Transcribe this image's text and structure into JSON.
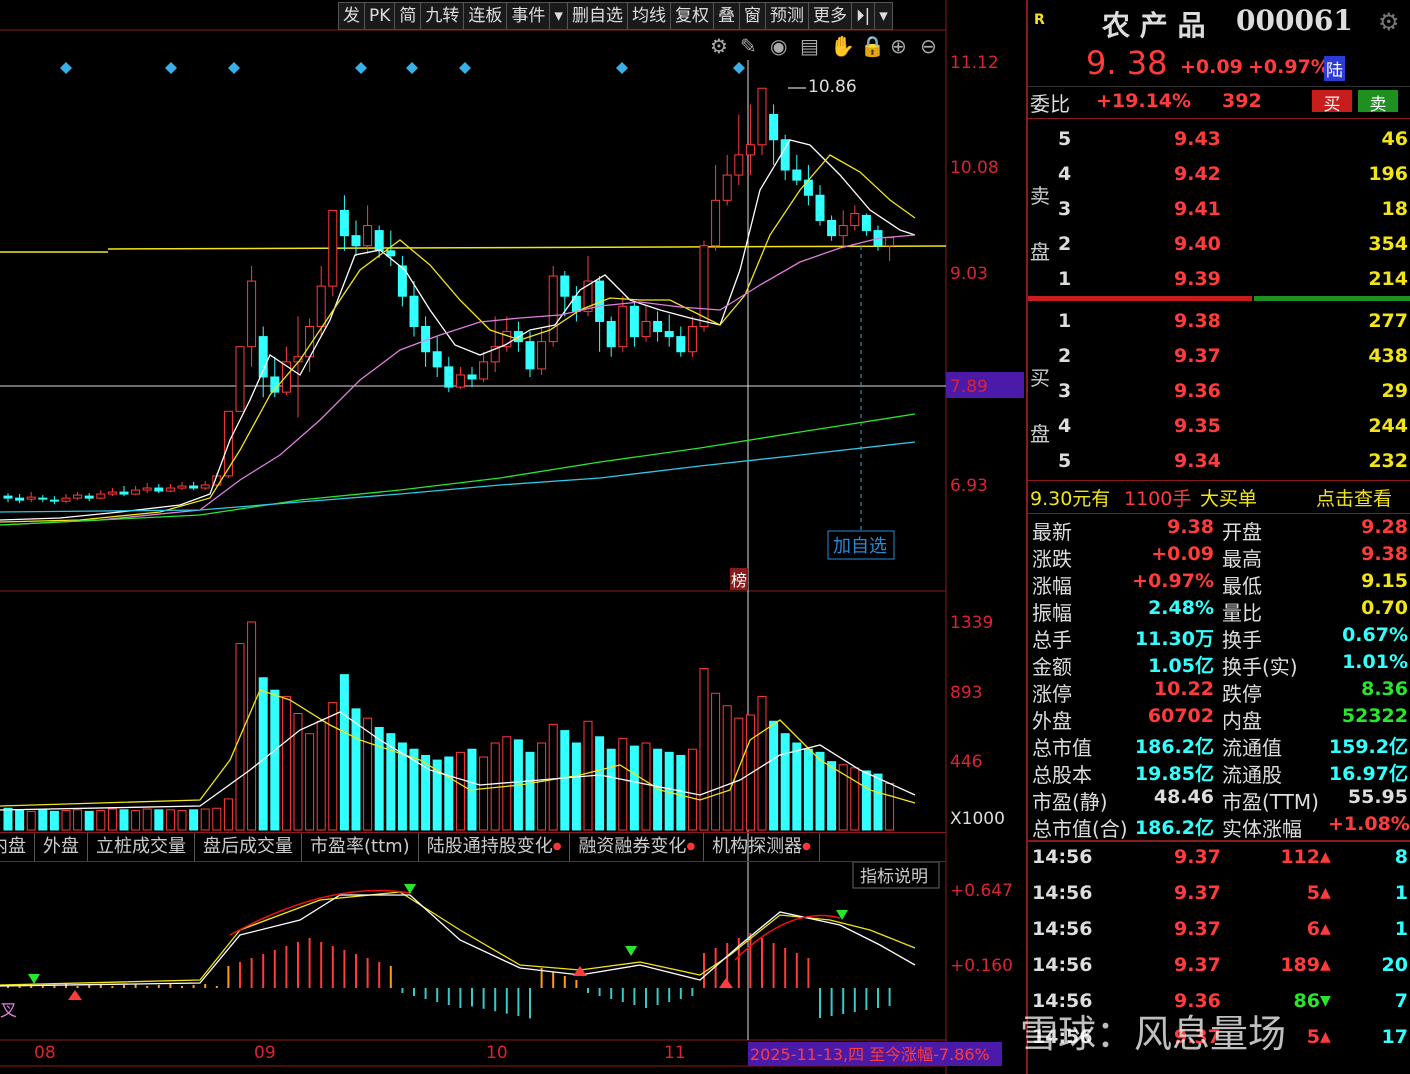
{
  "toolbar": [
    "发",
    "PK",
    "简",
    "九转",
    "连板",
    "事件",
    "▾",
    "删自选",
    "均线",
    "复权",
    "叠",
    "窗",
    "预测",
    "更多",
    "⏵|",
    "▾"
  ],
  "price_axis": [
    "11.12",
    "10.08",
    "9.03",
    "7.89",
    "6.93"
  ],
  "vol_axis": [
    "1339",
    "893",
    "446",
    "X1000"
  ],
  "macd_axis": [
    "+0.647",
    "+0.160"
  ],
  "x_axis": [
    "08",
    "09",
    "10",
    "11"
  ],
  "annotations": {
    "high": "10.86",
    "add_watch": "加自选",
    "bang": "榜",
    "indicator_help": "指标说明",
    "cross": "叉",
    "range_label": "2025-11-13,四 至今涨幅-7.86%"
  },
  "tabs": [
    {
      "label": "内盘",
      "dot": false
    },
    {
      "label": "外盘",
      "dot": false
    },
    {
      "label": "立桩成交量",
      "dot": false
    },
    {
      "label": "盘后成交量",
      "dot": false
    },
    {
      "label": "市盈率(ttm)",
      "dot": false
    },
    {
      "label": "陆股通持股变化",
      "dot": true
    },
    {
      "label": "融资融券变化",
      "dot": true
    },
    {
      "label": "机构探测器",
      "dot": true
    }
  ],
  "stock": {
    "badge": "R",
    "name": "农 产 品",
    "code": "000061",
    "price": "9. 38",
    "change": "+0.09",
    "pct": "+0.97%",
    "market": "陆"
  },
  "weibi": {
    "label": "委比",
    "value": "+19.14%",
    "diff": "392",
    "buy": "买",
    "sell": "卖"
  },
  "sell_side_label": [
    "卖",
    "盘"
  ],
  "buy_side_label": [
    "买",
    "盘"
  ],
  "sells": [
    {
      "n": "5",
      "p": "9.43",
      "v": "46"
    },
    {
      "n": "4",
      "p": "9.42",
      "v": "196"
    },
    {
      "n": "3",
      "p": "9.41",
      "v": "18"
    },
    {
      "n": "2",
      "p": "9.40",
      "v": "354"
    },
    {
      "n": "1",
      "p": "9.39",
      "v": "214"
    }
  ],
  "buys": [
    {
      "n": "1",
      "p": "9.38",
      "v": "277"
    },
    {
      "n": "2",
      "p": "9.37",
      "v": "438"
    },
    {
      "n": "3",
      "p": "9.36",
      "v": "29"
    },
    {
      "n": "4",
      "p": "9.35",
      "v": "244"
    },
    {
      "n": "5",
      "p": "9.34",
      "v": "232"
    }
  ],
  "big_order": {
    "text1": "9.30元有",
    "text2": "1100手",
    "text3": "大买单",
    "link": "点击查看"
  },
  "stats": [
    [
      "最新",
      "9.38",
      "red",
      "开盘",
      "9.28",
      "red"
    ],
    [
      "涨跌",
      "+0.09",
      "red",
      "最高",
      "9.38",
      "red"
    ],
    [
      "涨幅",
      "+0.97%",
      "red",
      "最低",
      "9.15",
      "yellow"
    ],
    [
      "振幅",
      "2.48%",
      "cyan",
      "量比",
      "0.70",
      "yellow"
    ],
    [
      "总手",
      "11.30万",
      "cyan",
      "换手",
      "0.67%",
      "cyan"
    ],
    [
      "金额",
      "1.05亿",
      "cyan",
      "换手(实)",
      "1.01%",
      "cyan"
    ],
    [
      "涨停",
      "10.22",
      "red",
      "跌停",
      "8.36",
      "green"
    ],
    [
      "外盘",
      "60702",
      "red",
      "内盘",
      "52322",
      "green"
    ],
    [
      "总市值",
      "186.2亿",
      "cyan",
      "流通值",
      "159.2亿",
      "cyan"
    ],
    [
      "总股本",
      "19.85亿",
      "cyan",
      "流通股",
      "16.97亿",
      "cyan"
    ],
    [
      "市盈(静)",
      "48.46",
      "white",
      "市盈(TTM)",
      "55.95",
      "white"
    ],
    [
      "总市值(合)",
      "186.2亿",
      "cyan",
      "实体涨幅",
      "+1.08%",
      "red"
    ]
  ],
  "ticks": [
    {
      "t": "14:56",
      "p": "9.37",
      "v": "112",
      "dir": "up",
      "n": "8"
    },
    {
      "t": "14:56",
      "p": "9.37",
      "v": "5",
      "dir": "up",
      "n": "1"
    },
    {
      "t": "14:56",
      "p": "9.37",
      "v": "6",
      "dir": "up",
      "n": "1"
    },
    {
      "t": "14:56",
      "p": "9.37",
      "v": "189",
      "dir": "up",
      "n": "20"
    },
    {
      "t": "14:56",
      "p": "9.36",
      "v": "86",
      "dir": "down",
      "n": "7"
    },
    {
      "t": "14:56",
      "p": "9.37",
      "v": "5",
      "dir": "up",
      "n": "17"
    }
  ],
  "watermark": "雪球：风息量场",
  "colors": {
    "up": "#ff3b3b",
    "down": "#3ff",
    "ma5": "#ffffff",
    "ma10": "#f2e418",
    "ma20": "#e07fe0",
    "ma60": "#27e62c",
    "ma120": "#2ec8e6",
    "frame": "#8b1a1a"
  }
}
